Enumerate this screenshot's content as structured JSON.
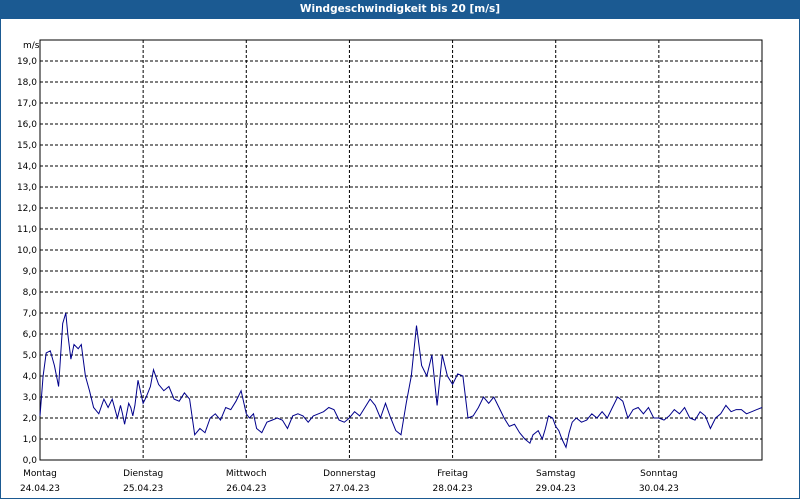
{
  "title": "Windgeschwindigkeit bis 20 [m/s]",
  "colors": {
    "titlebar": "#1b5a92",
    "line": "#00008b",
    "grid": "#000000"
  },
  "chart_data": {
    "type": "line",
    "title": "Windgeschwindigkeit bis 20 [m/s]",
    "ylabel": "m/s",
    "ylim": [
      0,
      20
    ],
    "xlim": [
      0,
      7
    ],
    "y_ticks": [
      "0,0",
      "1,0",
      "2,0",
      "3,0",
      "4,0",
      "5,0",
      "6,0",
      "7,0",
      "8,0",
      "9,0",
      "10,0",
      "11,0",
      "12,0",
      "13,0",
      "14,0",
      "15,0",
      "16,0",
      "17,0",
      "18,0",
      "19,0"
    ],
    "x_ticks": [
      {
        "day": "Montag",
        "date": "24.04.23"
      },
      {
        "day": "Dienstag",
        "date": "25.04.23"
      },
      {
        "day": "Mittwoch",
        "date": "26.04.23"
      },
      {
        "day": "Donnerstag",
        "date": "27.04.23"
      },
      {
        "day": "Freitag",
        "date": "28.04.23"
      },
      {
        "day": "Samstag",
        "date": "29.04.23"
      },
      {
        "day": "Sonntag",
        "date": "30.04.23"
      }
    ],
    "grid": true,
    "series": [
      {
        "x": [
          0.0,
          0.03,
          0.06,
          0.1,
          0.14,
          0.18,
          0.22,
          0.25,
          0.27,
          0.3,
          0.33,
          0.37,
          0.4,
          0.44,
          0.48,
          0.52,
          0.57,
          0.62,
          0.66,
          0.7,
          0.75,
          0.78,
          0.8,
          0.82,
          0.86,
          0.88,
          0.9,
          0.92,
          0.95,
          1.0,
          1.03,
          1.07,
          1.1,
          1.15,
          1.2,
          1.25,
          1.3,
          1.35,
          1.4,
          1.45,
          1.5,
          1.55,
          1.6,
          1.65,
          1.7,
          1.75,
          1.8,
          1.85,
          1.9,
          1.95,
          2.0,
          2.03,
          2.07,
          2.1,
          2.15,
          2.2,
          2.25,
          2.3,
          2.35,
          2.4,
          2.45,
          2.5,
          2.55,
          2.6,
          2.65,
          2.7,
          2.75,
          2.8,
          2.85,
          2.9,
          2.95,
          3.0,
          3.05,
          3.1,
          3.15,
          3.2,
          3.25,
          3.3,
          3.35,
          3.4,
          3.45,
          3.5,
          3.55,
          3.6,
          3.65,
          3.7,
          3.75,
          3.8,
          3.85,
          3.9,
          3.95,
          4.0,
          4.05,
          4.1,
          4.15,
          4.2,
          4.25,
          4.3,
          4.35,
          4.4,
          4.45,
          4.5,
          4.55,
          4.6,
          4.65,
          4.7,
          4.75,
          4.78,
          4.83,
          4.87,
          4.9,
          4.93,
          4.97,
          5.0,
          5.03,
          5.06,
          5.1,
          5.13,
          5.16,
          5.2,
          5.25,
          5.3,
          5.35,
          5.4,
          5.45,
          5.5,
          5.55,
          5.6,
          5.65,
          5.7,
          5.75,
          5.8,
          5.85,
          5.9,
          5.95,
          6.0,
          6.05,
          6.1,
          6.15,
          6.2,
          6.25,
          6.3,
          6.35,
          6.4,
          6.45,
          6.5,
          6.55,
          6.6,
          6.65,
          6.7,
          6.75,
          6.8,
          6.85,
          6.9,
          6.95,
          7.0
        ],
        "values": [
          2.1,
          4.0,
          5.1,
          5.2,
          4.5,
          3.5,
          6.5,
          7.0,
          6.0,
          4.8,
          5.5,
          5.3,
          5.5,
          4.0,
          3.3,
          2.5,
          2.2,
          2.9,
          2.5,
          2.9,
          2.0,
          2.6,
          2.2,
          1.7,
          2.7,
          2.5,
          2.1,
          2.6,
          3.8,
          2.7,
          3.0,
          3.5,
          4.3,
          3.6,
          3.3,
          3.5,
          2.9,
          2.8,
          3.2,
          2.9,
          1.2,
          1.5,
          1.3,
          2.0,
          2.2,
          1.9,
          2.5,
          2.4,
          2.8,
          3.3,
          2.2,
          2.0,
          2.2,
          1.5,
          1.3,
          1.8,
          1.9,
          2.0,
          1.9,
          1.5,
          2.1,
          2.2,
          2.1,
          1.8,
          2.1,
          2.2,
          2.3,
          2.5,
          2.4,
          1.9,
          1.8,
          2.0,
          2.3,
          2.1,
          2.5,
          2.9,
          2.6,
          2.0,
          2.7,
          2.0,
          1.4,
          1.2,
          2.7,
          4.0,
          6.4,
          4.5,
          4.0,
          5.0,
          2.6,
          5.0,
          4.0,
          3.6,
          4.1,
          4.0,
          2.0,
          2.1,
          2.5,
          3.0,
          2.7,
          3.0,
          2.5,
          2.0,
          1.6,
          1.7,
          1.3,
          1.0,
          0.8,
          1.2,
          1.4,
          1.0,
          1.5,
          2.1,
          2.0,
          1.6,
          1.4,
          1.0,
          0.6,
          1.3,
          1.8,
          2.0,
          1.8,
          1.9,
          2.2,
          2.0,
          2.3,
          2.0,
          2.5,
          3.0,
          2.8,
          2.0,
          2.4,
          2.5,
          2.2,
          2.5,
          2.0,
          2.0,
          1.9,
          2.1,
          2.4,
          2.2,
          2.5,
          2.0,
          1.9,
          2.3,
          2.1,
          1.5,
          2.0,
          2.2,
          2.6,
          2.3,
          2.4,
          2.4,
          2.2,
          2.3,
          2.4,
          2.5
        ]
      }
    ]
  }
}
